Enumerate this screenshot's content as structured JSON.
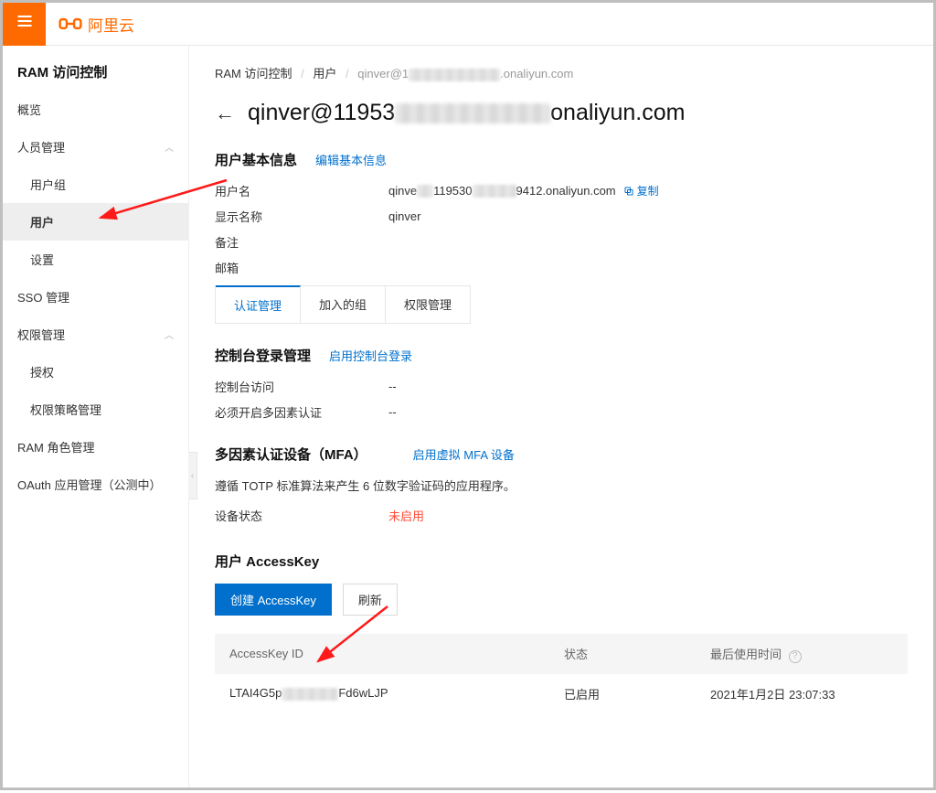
{
  "brand": "阿里云",
  "sidebar": {
    "title": "RAM 访问控制",
    "items": [
      {
        "label": "概览",
        "type": "item"
      },
      {
        "label": "人员管理",
        "type": "group"
      },
      {
        "label": "用户组",
        "type": "sub"
      },
      {
        "label": "用户",
        "type": "sub",
        "active": true
      },
      {
        "label": "设置",
        "type": "sub"
      },
      {
        "label": "SSO 管理",
        "type": "item"
      },
      {
        "label": "权限管理",
        "type": "group"
      },
      {
        "label": "授权",
        "type": "sub"
      },
      {
        "label": "权限策略管理",
        "type": "sub"
      },
      {
        "label": "RAM 角色管理",
        "type": "item"
      },
      {
        "label": "OAuth 应用管理（公测中）",
        "type": "item"
      }
    ]
  },
  "breadcrumb": {
    "a": "RAM 访问控制",
    "b": "用户",
    "c_prefix": "qinver@1",
    "c_suffix": ".onaliyun.com"
  },
  "title": {
    "prefix": "qinver@11953",
    "suffix": "onaliyun.com"
  },
  "basic": {
    "heading": "用户基本信息",
    "edit": "编辑基本信息",
    "rows": {
      "username_label": "用户名",
      "username_value_prefix": "qinve",
      "username_value_mid": "119530",
      "username_value_suffix": "9412.onaliyun.com",
      "copy": "复制",
      "display_label": "显示名称",
      "display_value": "qinver",
      "note_label": "备注",
      "email_label": "邮箱"
    }
  },
  "tabs": {
    "auth": "认证管理",
    "groups": "加入的组",
    "perm": "权限管理"
  },
  "console": {
    "heading": "控制台登录管理",
    "enable": "启用控制台登录",
    "access_label": "控制台访问",
    "mfa_label": "必须开启多因素认证",
    "dash": "--"
  },
  "mfa": {
    "heading": "多因素认证设备（MFA）",
    "enable": "启用虚拟 MFA 设备",
    "desc": "遵循 TOTP 标准算法来产生 6 位数字验证码的应用程序。",
    "status_label": "设备状态",
    "status_value": "未启用"
  },
  "ak": {
    "heading": "用户 AccessKey",
    "create": "创建 AccessKey",
    "refresh": "刷新",
    "cols": {
      "id": "AccessKey ID",
      "status": "状态",
      "last": "最后使用时间"
    },
    "row": {
      "id_prefix": "LTAI4G5p",
      "id_suffix": "Fd6wLJP",
      "status": "已启用",
      "last": "2021年1月2日 23:07:33"
    }
  }
}
